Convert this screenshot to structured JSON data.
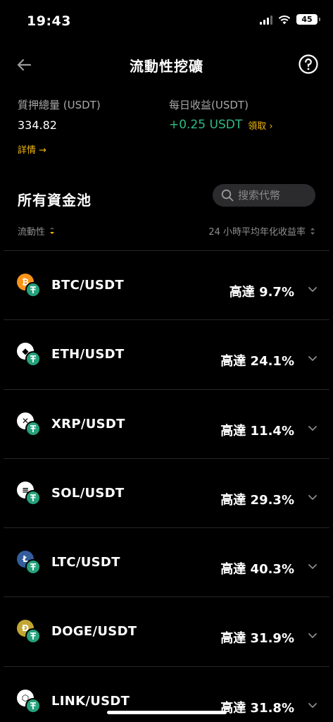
{
  "status_bar": {
    "time": "19:43",
    "battery": "45"
  },
  "nav": {
    "title": "流動性挖礦"
  },
  "summary": {
    "staked_label": "質押總量 (USDT)",
    "staked_value": "334.82",
    "detail_link": "詳情 →",
    "daily_label": "每日收益(USDT)",
    "daily_value": "+0.25 USDT",
    "claim_link": "領取 ›"
  },
  "pools_section": {
    "title": "所有資金池",
    "search_placeholder": "搜索代幣",
    "sort_left": "流動性",
    "sort_right": "24 小時平均年化收益率"
  },
  "colors": {
    "accent": "#f0b90b",
    "positive": "#2ebd85",
    "usdt": "#26a17b"
  },
  "pools": [
    {
      "pair": "BTC/USDT",
      "apy": "高達 9.7%",
      "icon": "btc-icon",
      "color": "#f7931a",
      "glyph": "₿"
    },
    {
      "pair": "ETH/USDT",
      "apy": "高達 24.1%",
      "icon": "eth-icon",
      "color": "#ffffff",
      "glyph": "◆"
    },
    {
      "pair": "XRP/USDT",
      "apy": "高達 11.4%",
      "icon": "xrp-icon",
      "color": "#ffffff",
      "glyph": "✕"
    },
    {
      "pair": "SOL/USDT",
      "apy": "高達 29.3%",
      "icon": "sol-icon",
      "color": "#ffffff",
      "glyph": "≡"
    },
    {
      "pair": "LTC/USDT",
      "apy": "高達 40.3%",
      "icon": "ltc-icon",
      "color": "#345d9d",
      "glyph": "Ł"
    },
    {
      "pair": "DOGE/USDT",
      "apy": "高達 31.9%",
      "icon": "doge-icon",
      "color": "#c2a633",
      "glyph": "Ð"
    },
    {
      "pair": "LINK/USDT",
      "apy": "高達 31.8%",
      "icon": "link-icon",
      "color": "#ffffff",
      "glyph": "⬡"
    }
  ]
}
